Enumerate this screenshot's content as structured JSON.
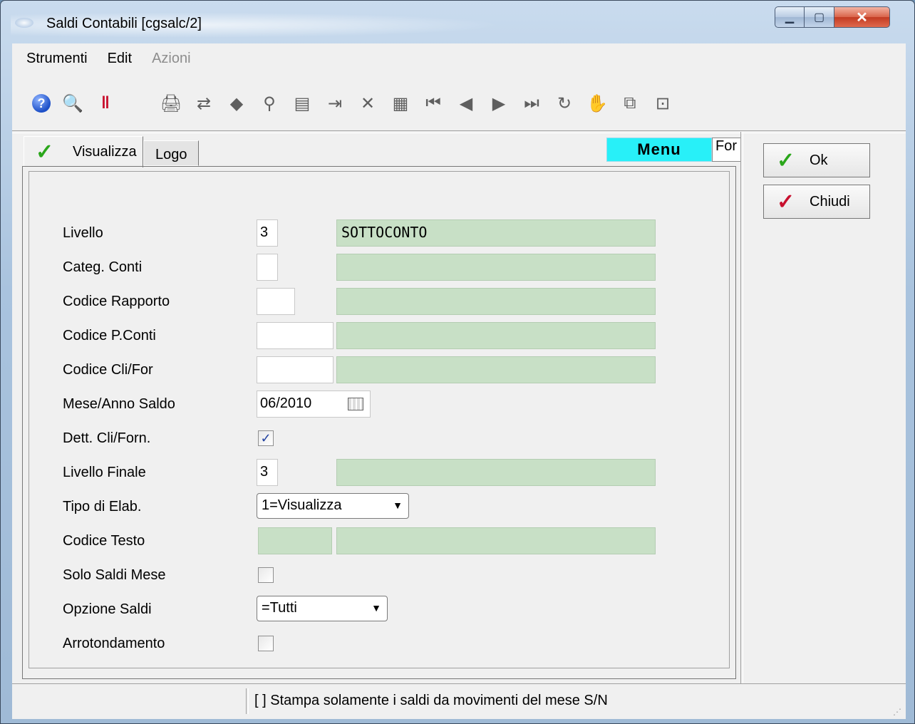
{
  "window": {
    "title": "Saldi Contabili [cgsalc/2]"
  },
  "menubar": {
    "items": [
      "Strumenti",
      "Edit",
      "Azioni"
    ]
  },
  "toolbar": {
    "icons": [
      "help-icon",
      "preview-icon",
      "bookmark-icon",
      "monitor-icon",
      "printer-icon",
      "export-icon",
      "diamond-icon",
      "search-key-icon",
      "document-icon",
      "enter-icon",
      "delete-icon",
      "calc-icon",
      "first-icon",
      "prev-icon",
      "next-icon",
      "last-icon",
      "refresh-icon",
      "hand-icon",
      "copy-icon",
      "settings-icon"
    ]
  },
  "tabs": {
    "visualizza": "Visualizza",
    "logo": "Logo",
    "menu": "Menu",
    "for": "For"
  },
  "form": {
    "livello": {
      "label": "Livello",
      "value": "3",
      "desc": "SOTTOCONTO"
    },
    "categ_conti": {
      "label": "Categ. Conti",
      "value": "",
      "desc": ""
    },
    "codice_rapporto": {
      "label": "Codice Rapporto",
      "value": "",
      "desc": ""
    },
    "codice_pconti": {
      "label": "Codice P.Conti",
      "value": "",
      "desc": ""
    },
    "codice_clifor": {
      "label": "Codice Cli/For",
      "value": "",
      "desc": ""
    },
    "mese_anno_saldo": {
      "label": "Mese/Anno Saldo",
      "value": "06/2010"
    },
    "dett_cliforn": {
      "label": "Dett. Cli/Forn.",
      "checked": true
    },
    "livello_finale": {
      "label": "Livello Finale",
      "value": "3",
      "desc": ""
    },
    "tipo_elab": {
      "label": "Tipo di Elab.",
      "value": "1=Visualizza"
    },
    "codice_testo": {
      "label": "Codice Testo",
      "value": "",
      "desc": ""
    },
    "solo_saldi_mese": {
      "label": "Solo Saldi Mese",
      "checked": false
    },
    "opzione_saldi": {
      "label": "Opzione Saldi",
      "value": "=Tutti"
    },
    "arrotondamento": {
      "label": "Arrotondamento",
      "checked": false
    }
  },
  "buttons": {
    "ok": "Ok",
    "chiudi": "Chiudi"
  },
  "status": {
    "text": "[ ] Stampa solamente i saldi da movimenti del mese S/N"
  },
  "colors": {
    "field_green": "#c8e0c6",
    "menu_cyan": "#28f0f8",
    "check_green": "#2aa61a",
    "check_red": "#c8102e"
  }
}
